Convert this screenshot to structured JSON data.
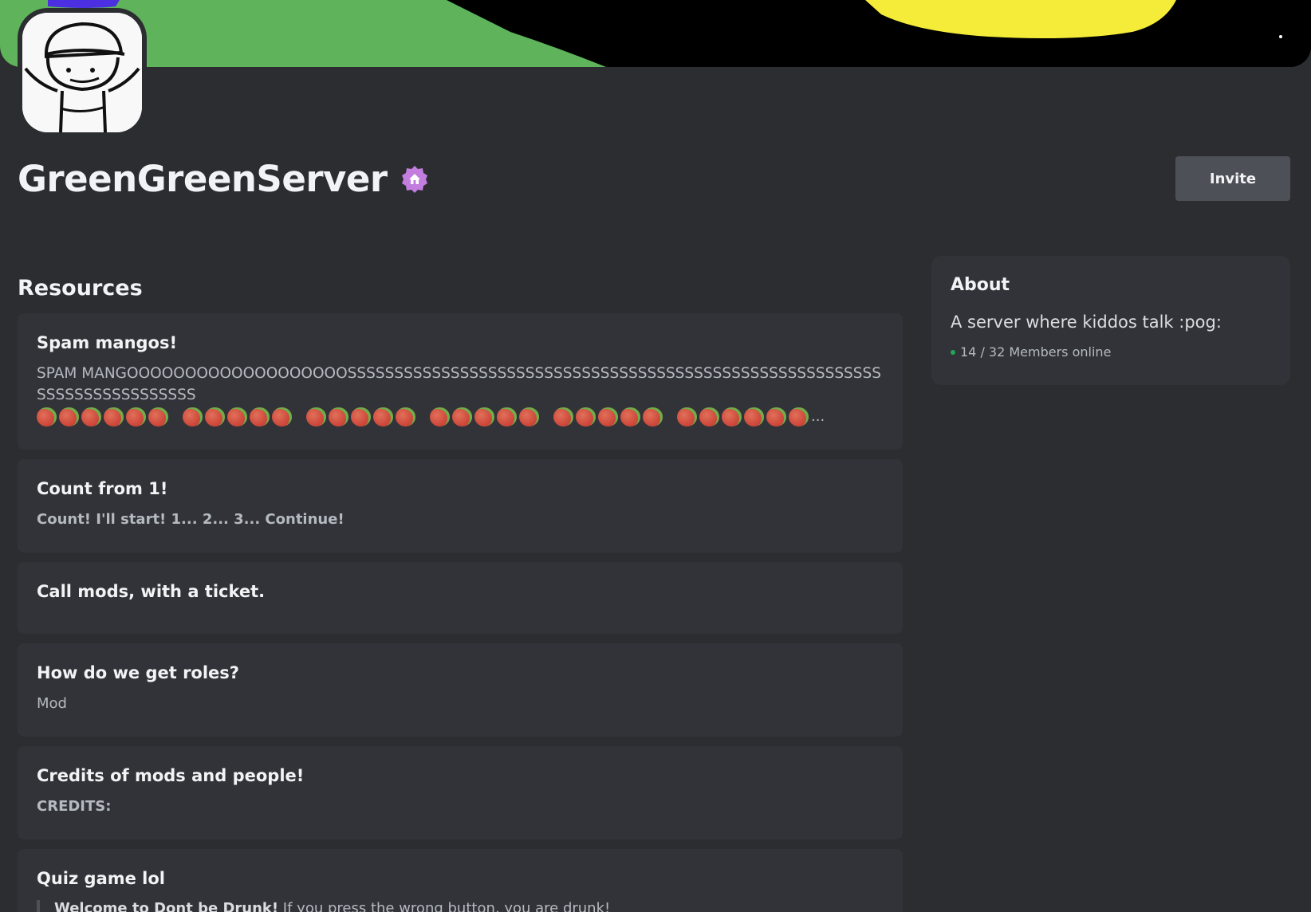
{
  "server": {
    "name": "GreenGreenServer",
    "invite_label": "Invite"
  },
  "resources": {
    "heading": "Resources",
    "items": [
      {
        "title": "Spam mangos!",
        "description": "SPAM MANGOOOOOOOOOOOOOOOOOOOSSSSSSSSSSSSSSSSSSSSSSSSSSSSSSSSSSSSSSSSSSSSSSSSSSSSSSSSSSSSSSSSSSSSSSSSSS",
        "ellipsis": "...",
        "emoji": "mango"
      },
      {
        "title": "Count from 1!",
        "description": "Count! I'll start! 1... 2... 3... Continue!"
      },
      {
        "title": "Call mods, with a ticket.",
        "description": ""
      },
      {
        "title": "How do we get roles?",
        "description": "Mod"
      },
      {
        "title": "Credits of mods and people!",
        "description": "CREDITS:"
      },
      {
        "title": "Quiz game lol",
        "quote_bold": "Welcome to Dont be Drunk!",
        "quote_text": " If you press the wrong button, you are drunk!"
      }
    ]
  },
  "about": {
    "title": "About",
    "description": "A server where kiddos talk :pog:",
    "members_online": "14 / 32 Members online"
  },
  "colors": {
    "background": "#2b2d31",
    "card": "#313338",
    "button": "#4e5058",
    "online": "#23a55a",
    "badge": "#c27ddf"
  }
}
